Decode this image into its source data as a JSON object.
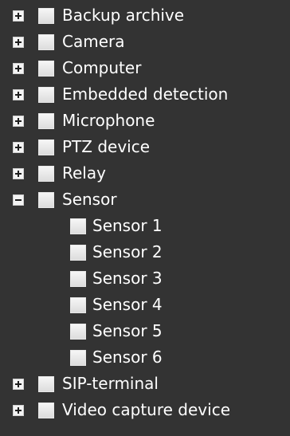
{
  "tree": {
    "items": [
      {
        "label": "Backup archive",
        "expanded": false
      },
      {
        "label": "Camera",
        "expanded": false
      },
      {
        "label": "Computer",
        "expanded": false
      },
      {
        "label": "Embedded detection",
        "expanded": false
      },
      {
        "label": "Microphone",
        "expanded": false
      },
      {
        "label": "PTZ device",
        "expanded": false
      },
      {
        "label": "Relay",
        "expanded": false
      },
      {
        "label": "Sensor",
        "expanded": true,
        "children": [
          {
            "label": "Sensor 1"
          },
          {
            "label": "Sensor 2"
          },
          {
            "label": "Sensor 3"
          },
          {
            "label": "Sensor 4"
          },
          {
            "label": "Sensor 5"
          },
          {
            "label": "Sensor 6"
          }
        ]
      },
      {
        "label": "SIP-terminal",
        "expanded": false
      },
      {
        "label": "Video capture device",
        "expanded": false
      }
    ]
  }
}
